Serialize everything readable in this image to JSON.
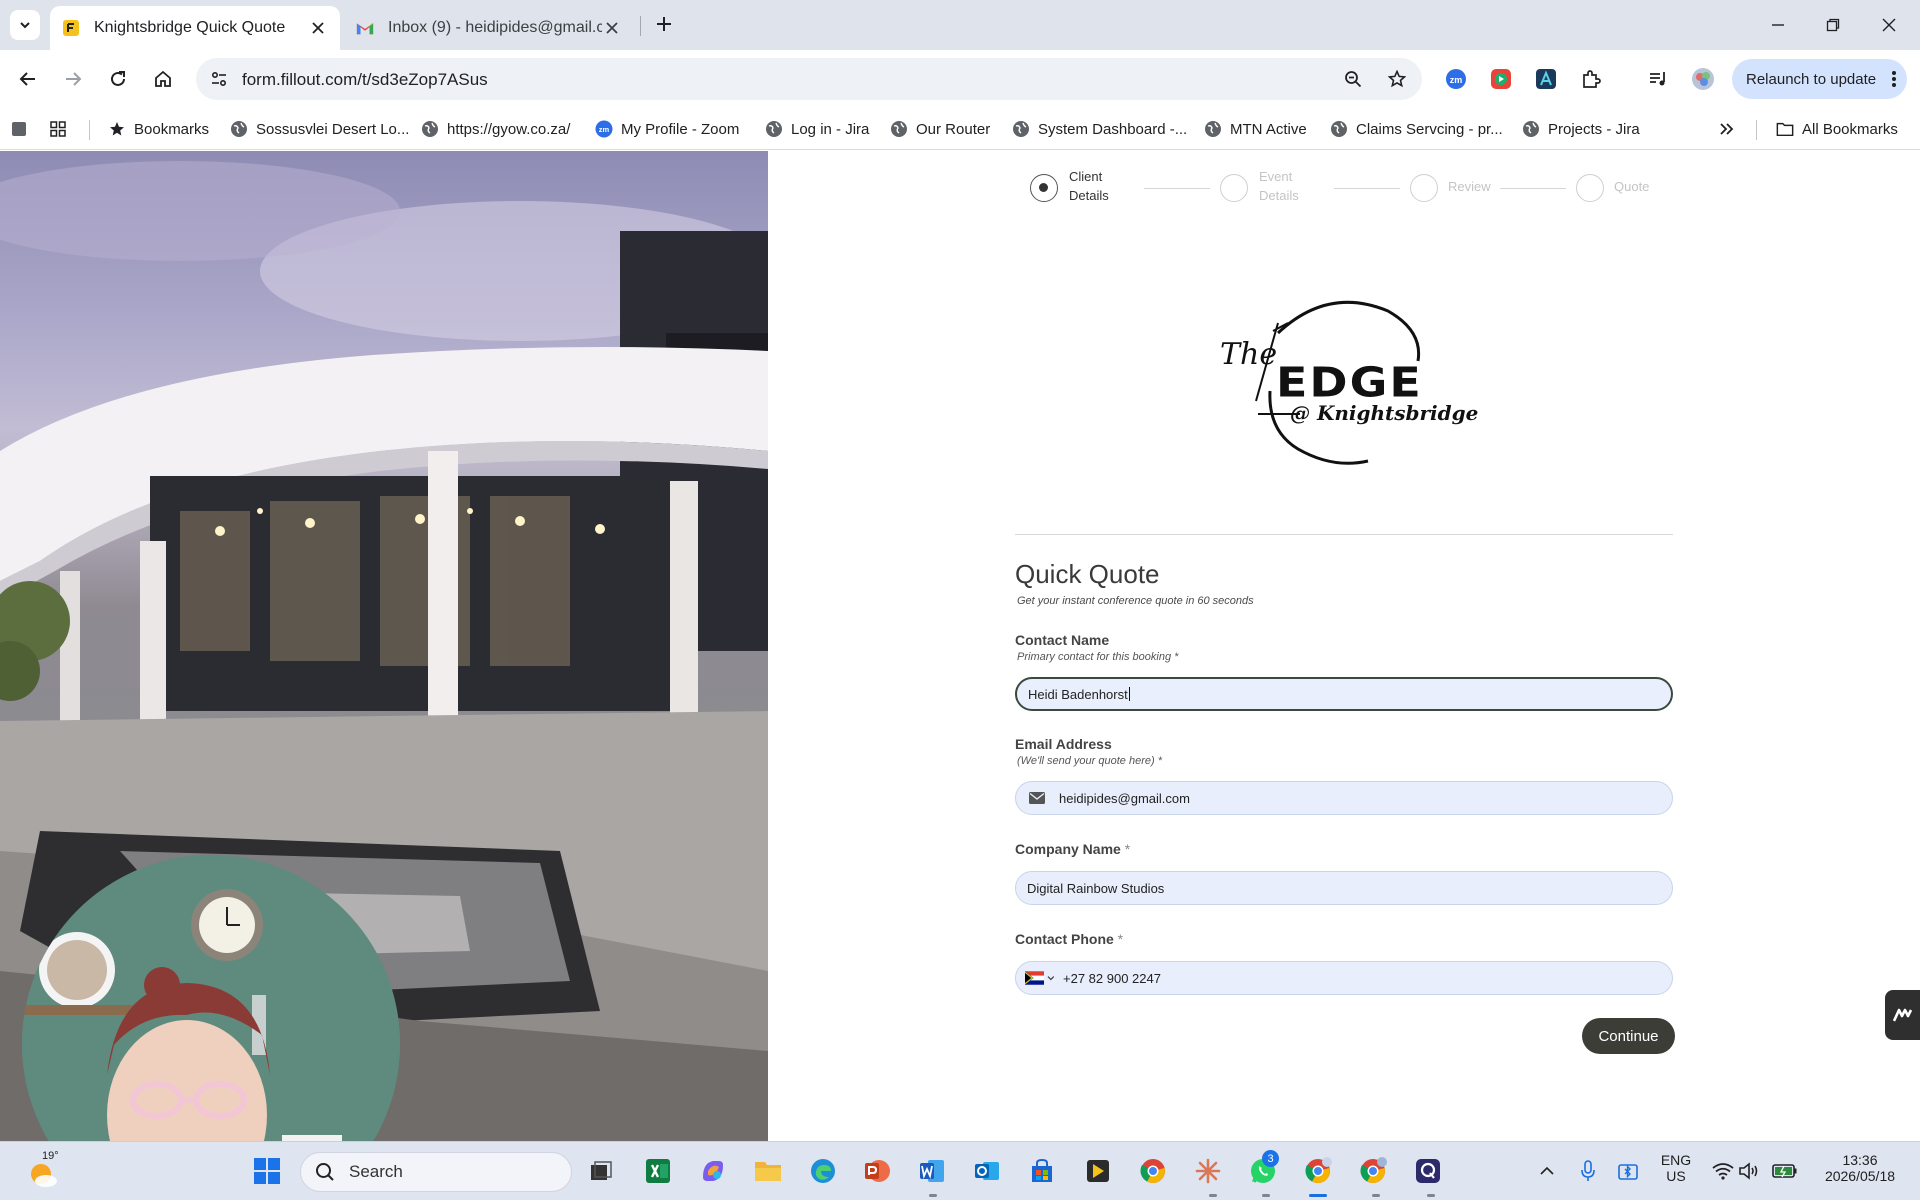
{
  "browser": {
    "tabs": [
      {
        "title": "Knightsbridge Quick Quote",
        "active": true
      },
      {
        "title": "Inbox (9) - heidipides@gmail.co",
        "active": false
      }
    ],
    "url": "form.fillout.com/t/sd3eZop7ASus",
    "relaunch_label": "Relaunch to update",
    "bookmarks": [
      {
        "label": "Bookmarks",
        "icon": "star-icon"
      },
      {
        "label": "Sossusvlei Desert Lo...",
        "icon": "globe-icon"
      },
      {
        "label": "https://gyow.co.za/",
        "icon": "globe-icon"
      },
      {
        "label": "My Profile - Zoom",
        "icon": "zoom-icon"
      },
      {
        "label": "Log in - Jira",
        "icon": "globe-icon"
      },
      {
        "label": "Our Router",
        "icon": "globe-icon"
      },
      {
        "label": "System Dashboard -...",
        "icon": "globe-icon"
      },
      {
        "label": "MTN Active",
        "icon": "globe-icon"
      },
      {
        "label": "Claims Servcing - pr...",
        "icon": "globe-icon"
      },
      {
        "label": "Projects - Jira",
        "icon": "globe-icon"
      }
    ],
    "all_bookmarks_label": "All Bookmarks"
  },
  "form": {
    "steps": [
      {
        "line1": "Client",
        "line2": "Details",
        "active": true
      },
      {
        "line1": "Event",
        "line2": "Details",
        "active": false
      },
      {
        "line1": "Review",
        "line2": "",
        "active": false
      },
      {
        "line1": "Quote",
        "line2": "",
        "active": false
      }
    ],
    "logo": {
      "line1": "The",
      "line2": "EDGE",
      "line3": "@ Knightsbridge"
    },
    "heading": "Quick Quote",
    "subheading": "Get your instant conference quote in 60 seconds",
    "contact_name": {
      "label": "Contact Name",
      "help": "Primary contact for this booking",
      "required_mark": "*",
      "value": "Heidi Badenhorst"
    },
    "email": {
      "label": "Email Address",
      "help": "(We'll send your quote here)",
      "required_mark": "*",
      "value": "heidipides@gmail.com"
    },
    "company": {
      "label": "Company Name",
      "required_mark": "*",
      "value": "Digital Rainbow Studios"
    },
    "phone": {
      "label": "Contact Phone",
      "required_mark": "*",
      "value": "+27 82 900 2247"
    },
    "continue_label": "Continue"
  },
  "taskbar": {
    "temperature": "19°",
    "search_placeholder": "Search",
    "whatsapp_badge": "3",
    "language_line1": "ENG",
    "language_line2": "US",
    "time": "13:36",
    "date": "2026/05/18"
  },
  "colors": {
    "accent": "#1a73e8",
    "continue_button": "#3d3d38",
    "field_background": "#e8eefb",
    "relaunch_background": "#d3e3fd"
  }
}
